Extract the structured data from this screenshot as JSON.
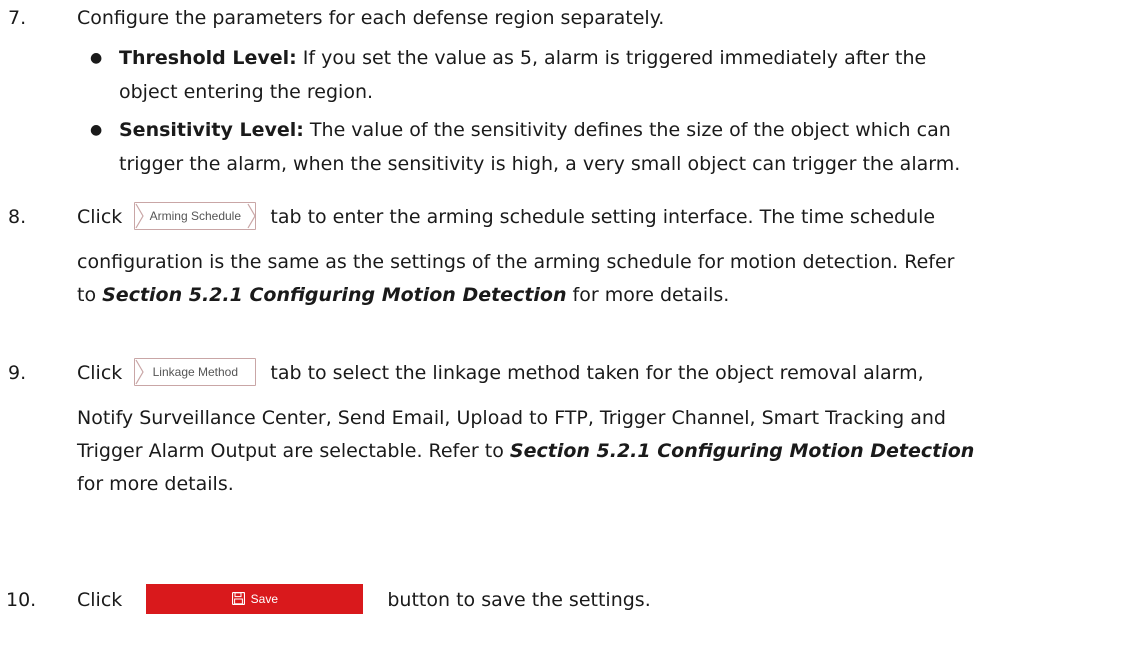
{
  "steps": {
    "s7": {
      "num": "7.",
      "text": "Configure the parameters for each defense region separately.",
      "bullets": [
        {
          "label": "Threshold Level:",
          "line1": " If you set the value as 5, alarm is triggered immediately after the",
          "line2": "object entering the region."
        },
        {
          "label": "Sensitivity Level:",
          "line1": " The value of the sensitivity defines the size of the object which can",
          "line2": "trigger the alarm, when the sensitivity is high, a very small object can trigger the alarm."
        }
      ]
    },
    "s8": {
      "num": "8.",
      "click": "Click",
      "tab_label": "Arming Schedule",
      "line1_rest": "tab to enter the arming schedule setting interface. The time schedule",
      "line2": "configuration is the same as the settings of the arming schedule for motion detection. Refer",
      "line3_pre": "to ",
      "line3_ref": "Section 5.2.1 Configuring Motion Detection",
      "line3_post": " for more details."
    },
    "s9": {
      "num": "9.",
      "click": "Click",
      "tab_label": "Linkage Method",
      "line1_rest": "tab to select the linkage method taken for the object removal alarm,",
      "line2": "Notify Surveillance Center, Send Email, Upload to FTP, Trigger Channel, Smart Tracking and",
      "line3_pre": "Trigger Alarm Output are selectable. Refer to ",
      "line3_ref": "Section 5.2.1 Configuring Motion Detection",
      "line4": "for more details."
    },
    "s10": {
      "num": "10.",
      "click": "Click",
      "button_label": "Save",
      "rest": "button to save the settings."
    }
  },
  "colors": {
    "save_button": "#d9191c",
    "tab_border": "#c9a6a6"
  },
  "icons": {
    "save": "floppy-disk-icon",
    "bullet": "filled-circle-bullet"
  }
}
